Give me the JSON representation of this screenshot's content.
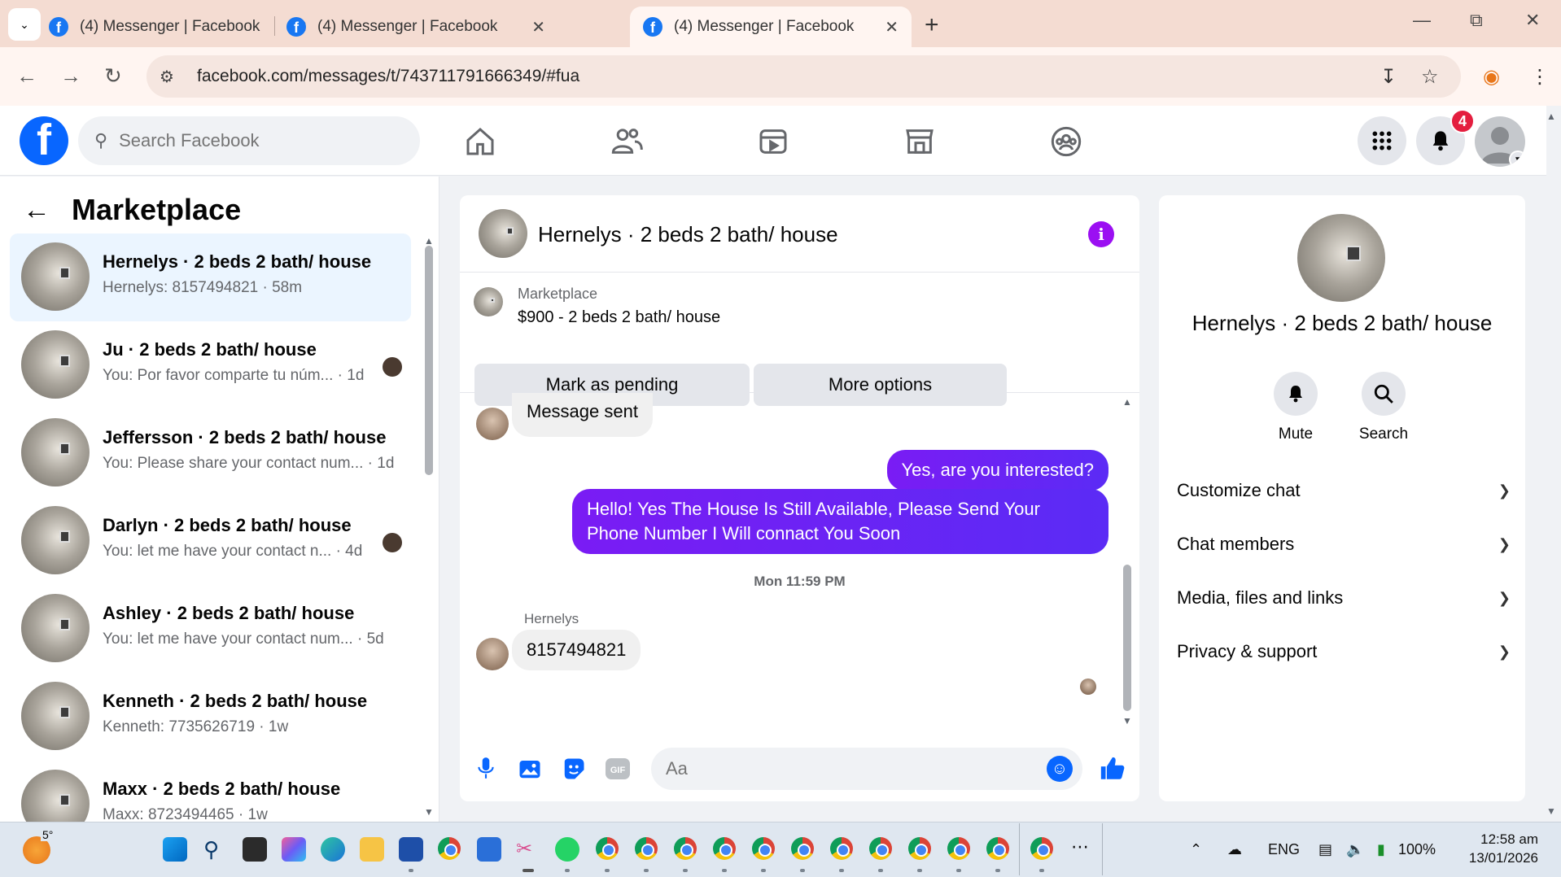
{
  "browser": {
    "tabs": [
      {
        "title": "(4) Messenger | Facebook",
        "active": false
      },
      {
        "title": "(4) Messenger | Facebook",
        "active": false
      },
      {
        "title": "(4) Messenger | Facebook",
        "active": true
      }
    ],
    "new_tab_label": "+",
    "url": "facebook.com/messages/t/743711791666349/#fua"
  },
  "fb_header": {
    "search_placeholder": "Search Facebook",
    "notification_count": "4",
    "nav_icons": [
      "home-icon",
      "friends-icon",
      "video-icon",
      "marketplace-icon",
      "groups-icon"
    ]
  },
  "left_panel": {
    "title": "Marketplace",
    "conversations": [
      {
        "name": "Hernelys · 2 beds 2 bath/ house",
        "snippet": "Hernelys: 8157494821 · 58m",
        "active": true
      },
      {
        "name": "Ju · 2 beds 2 bath/ house",
        "snippet": "You: Por favor comparte tu núm... · 1d"
      },
      {
        "name": "Jeffersson · 2 beds 2 bath/ house",
        "snippet": "You: Please share your contact num... · 1d"
      },
      {
        "name": "Darlyn · 2 beds 2 bath/ house",
        "snippet": "You: let me have your contact n... · 4d"
      },
      {
        "name": "Ashley · 2 beds 2 bath/ house",
        "snippet": "You: let me have your contact num... · 5d"
      },
      {
        "name": "Kenneth · 2 beds 2 bath/ house",
        "snippet": "Kenneth: 7735626719 · 1w"
      },
      {
        "name": "Maxx · 2 beds 2 bath/ house",
        "snippet": "Maxx: 8723494465 · 1w"
      }
    ]
  },
  "chat": {
    "title": "Hernelys · 2 beds 2 bath/ house",
    "listing": {
      "category": "Marketplace",
      "price_title": "$900 - 2 beds 2 bath/ house",
      "mark_pending_label": "Mark as pending",
      "more_options_label": "More options"
    },
    "messages": {
      "sent_notice": "Message sent",
      "out_1": "Yes, are you interested?",
      "out_2": "Hello! Yes The House  Is Still Available, Please Send Your Phone Number I Will connact You Soon",
      "timestamp": "Mon 11:59 PM",
      "sender": "Hernelys",
      "in_1": "8157494821"
    },
    "composer_placeholder": "Aa"
  },
  "right_panel": {
    "name": "Hernelys · 2 beds 2 bath/ house",
    "mute_label": "Mute",
    "search_label": "Search",
    "sections": [
      "Customize chat",
      "Chat members",
      "Media, files and links",
      "Privacy & support"
    ]
  },
  "taskbar": {
    "temperature": "5°",
    "language": "ENG",
    "battery": "100%",
    "time": "12:58 am",
    "date": "13/01/2026"
  },
  "colors": {
    "fb_blue": "#0866ff",
    "outgoing_bubble": "#6a23f4",
    "info_purple": "#9b0ff2",
    "badge_red": "#e41e3f",
    "active_conv_bg": "#ebf5ff"
  }
}
